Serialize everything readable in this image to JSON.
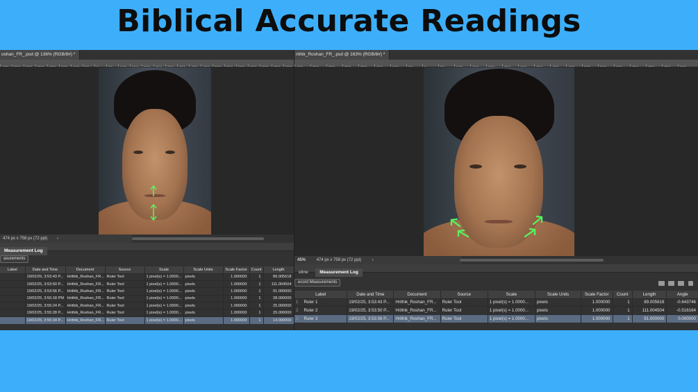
{
  "headline": "Biblical Accurate Readings",
  "left": {
    "doc_tab": "oshan_FR_.psd @ 136% (RGB/8#) *",
    "ruler_ticks": [
      "400",
      "350",
      "300",
      "250",
      "200",
      "150",
      "100",
      "50",
      "0",
      "50",
      "100",
      "150",
      "200",
      "250",
      "300",
      "350",
      "400",
      "450",
      "500",
      "550",
      "600",
      "650",
      "700",
      "750",
      "800"
    ],
    "status": "474 px x 758 px (72 ppi)",
    "tabs": [
      "Measurement Log"
    ],
    "record_label": "asurements",
    "columns": [
      "Label",
      "Date and Time",
      "Document",
      "Source",
      "Scale",
      "Scale Units",
      "Scale Factor",
      "Count",
      "Length"
    ],
    "rows": [
      [
        "",
        "19/02/25, 3:53:43 P...",
        "Hrithik_Roshan_FR...",
        "Ruler Tool",
        "1 pixel(s) = 1.0000...",
        "pixels",
        "1.000000",
        "1",
        "89.005618"
      ],
      [
        "",
        "19/02/25, 3:53:50 P...",
        "Hrithik_Roshan_FR...",
        "Ruler Tool",
        "1 pixel(s) = 1.0000...",
        "pixels",
        "1.000000",
        "1",
        "111.004504"
      ],
      [
        "",
        "19/02/25, 3:53:56 P...",
        "Hrithik_Roshan_FR...",
        "Ruler Tool",
        "1 pixel(s) = 1.0000...",
        "pixels",
        "1.000000",
        "1",
        "91.000000"
      ],
      [
        "",
        "19/02/25, 3:55:18 PM",
        "Hrithik_Roshan_FR...",
        "Ruler Tool",
        "1 pixel(s) = 1.0000...",
        "pixels",
        "1.000000",
        "1",
        "28.000000"
      ],
      [
        "",
        "19/02/25, 3:55:24 P...",
        "Hrithik_Roshan_FR...",
        "Ruler Tool",
        "1 pixel(s) = 1.0000...",
        "pixels",
        "1.000000",
        "1",
        "25.000000"
      ],
      [
        "",
        "19/02/25, 3:55:28 P...",
        "Hrithik_Roshan_FR...",
        "Ruler Tool",
        "1 pixel(s) = 1.0000...",
        "pixels",
        "1.000000",
        "1",
        "25.000000"
      ],
      [
        "",
        "19/02/25, 3:55:34 P...",
        "Hrithik_Roshan_FR...",
        "Ruler Tool",
        "1 pixel(s) = 1.0000...",
        "pixels",
        "1.000000",
        "1",
        "14.000000"
      ]
    ],
    "selected_row": 6
  },
  "right": {
    "doc_tab": "rithik_Roshan_FR_.psd @ 163% (RGB/8#) *",
    "ruler_ticks": [
      "400",
      "350",
      "300",
      "250",
      "200",
      "150",
      "100",
      "50",
      "0",
      "50",
      "100",
      "150",
      "200",
      "250",
      "300",
      "350",
      "400",
      "450",
      "500",
      "550",
      "600",
      "650",
      "700",
      "750",
      "800"
    ],
    "zoom": "45%",
    "status": "474 px x 758 px (72 ppi)",
    "tabs": [
      "eline",
      "Measurement Log"
    ],
    "record_label": "ecord Measurements",
    "columns": [
      "Label",
      "Date and Time",
      "Document",
      "Source",
      "Scale",
      "Scale Units",
      "Scale Factor",
      "Count",
      "Length",
      "Angle"
    ],
    "rows": [
      [
        "Ruler 1",
        "19/02/25, 3:53:43 P...",
        "Hrithik_Roshan_FR...",
        "Ruler Tool",
        "1 pixel(s) = 1.0000...",
        "pixels",
        "1.000000",
        "1",
        "89.005618",
        "-0.643746"
      ],
      [
        "Ruler 2",
        "19/02/25, 3:53:50 P...",
        "Hrithik_Roshan_FR...",
        "Ruler Tool",
        "1 pixel(s) = 1.0000...",
        "pixels",
        "1.000000",
        "1",
        "111.004504",
        "-0.516164"
      ],
      [
        "Ruler 3",
        "19/02/25, 3:53:56 P...",
        "Hrithik_Roshan_FR...",
        "Ruler Tool",
        "1 pixel(s) = 1.0000...",
        "pixels",
        "1.000000",
        "1",
        "91.000000",
        "0.000000"
      ]
    ],
    "row_markers": [
      "1",
      "2",
      "3"
    ],
    "selected_row": 2
  },
  "colors": {
    "background": "#3daffa",
    "panel": "#323232",
    "annotation_green": "#5cf05c",
    "selection": "#5a6b82"
  }
}
